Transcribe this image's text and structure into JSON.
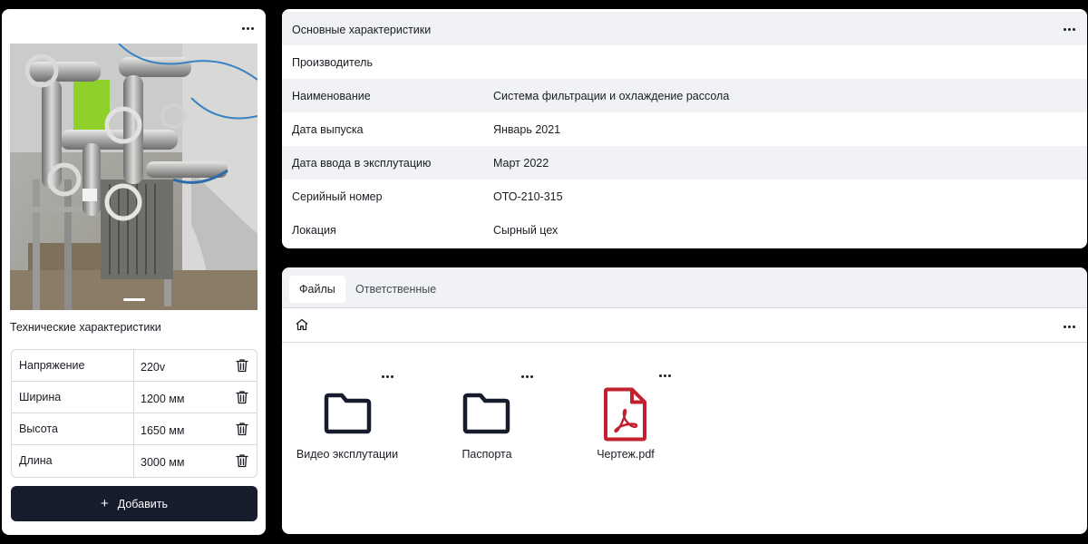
{
  "left_card": {
    "spec_title": "Технические характеристики",
    "specs": [
      {
        "name": "Напряжение",
        "value": "220v"
      },
      {
        "name": "Ширина",
        "value": "1200 мм"
      },
      {
        "name": "Высота",
        "value": "1650 мм"
      },
      {
        "name": "Длина",
        "value": "3000 мм"
      }
    ],
    "add_button": {
      "icon": "+",
      "label": "Добавить"
    }
  },
  "main_card": {
    "title": "Основные характеристики",
    "rows": [
      {
        "key": "Производитель",
        "value": ""
      },
      {
        "key": "Наименование",
        "value": "Система фильтрации и охлаждение рассола"
      },
      {
        "key": "Дата выпуска",
        "value": "Январь 2021"
      },
      {
        "key": "Дата ввода в эксплутацию",
        "value": "Март 2022"
      },
      {
        "key": "Серийный номер",
        "value": "ОТО-210-315"
      },
      {
        "key": "Локация",
        "value": "Сырный цех"
      }
    ]
  },
  "files_card": {
    "tabs": [
      {
        "label": "Файлы",
        "active": true
      },
      {
        "label": "Ответственные",
        "active": false
      }
    ],
    "items": [
      {
        "type": "folder",
        "label": "Видео эксплутации"
      },
      {
        "type": "folder",
        "label": "Паспорта"
      },
      {
        "type": "pdf",
        "label": "Чертеж.pdf"
      }
    ]
  },
  "colors": {
    "dark_button": "#161c2c",
    "pdf_red": "#c3202e",
    "shaded_row": "#f1f2f5"
  }
}
